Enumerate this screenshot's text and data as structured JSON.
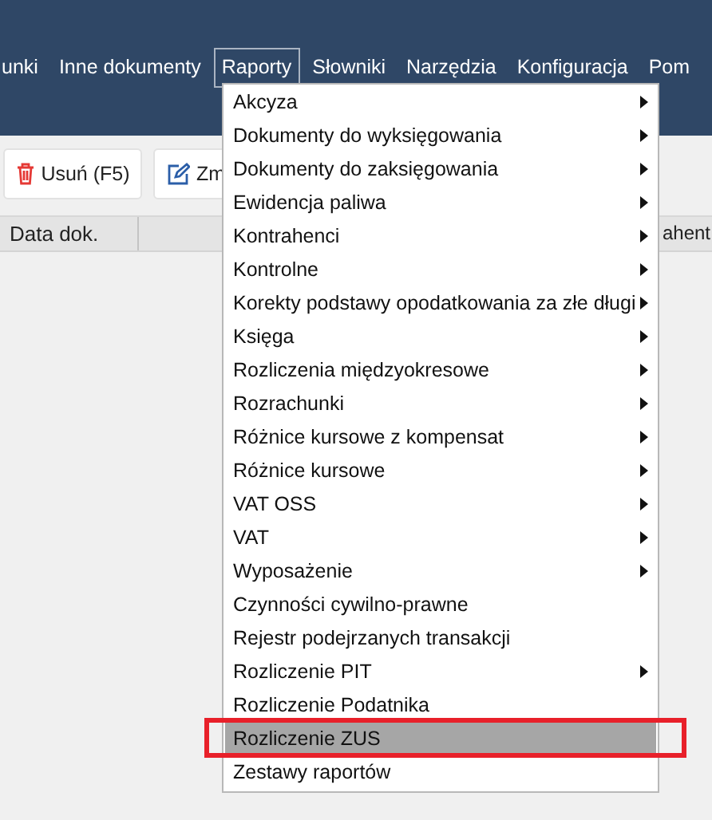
{
  "menu_bar": [
    {
      "label": "unki",
      "open": false
    },
    {
      "label": "Inne dokumenty",
      "open": false
    },
    {
      "label": "Raporty",
      "open": true
    },
    {
      "label": "Słowniki",
      "open": false
    },
    {
      "label": "Narzędzia",
      "open": false
    },
    {
      "label": "Konfiguracja",
      "open": false
    },
    {
      "label": "Pom",
      "open": false
    }
  ],
  "toolbar": [
    {
      "kind": "delete",
      "label": "Usuń (F5)"
    },
    {
      "kind": "edit",
      "label": "Zm"
    }
  ],
  "table": {
    "columns": [
      "Data dok.",
      "ahent"
    ]
  },
  "dropdown": {
    "items": [
      {
        "label": "Akcyza",
        "submenu": true,
        "selected": false
      },
      {
        "label": "Dokumenty do wyksięgowania",
        "submenu": true,
        "selected": false
      },
      {
        "label": "Dokumenty do zaksięgowania",
        "submenu": true,
        "selected": false
      },
      {
        "label": "Ewidencja paliwa",
        "submenu": true,
        "selected": false
      },
      {
        "label": "Kontrahenci",
        "submenu": true,
        "selected": false
      },
      {
        "label": "Kontrolne",
        "submenu": true,
        "selected": false
      },
      {
        "label": "Korekty podstawy opodatkowania za złe długi",
        "submenu": true,
        "selected": false
      },
      {
        "label": "Księga",
        "submenu": true,
        "selected": false
      },
      {
        "label": "Rozliczenia międzyokresowe",
        "submenu": true,
        "selected": false
      },
      {
        "label": "Rozrachunki",
        "submenu": true,
        "selected": false
      },
      {
        "label": "Różnice kursowe z kompensat",
        "submenu": true,
        "selected": false
      },
      {
        "label": "Różnice kursowe",
        "submenu": true,
        "selected": false
      },
      {
        "label": "VAT OSS",
        "submenu": true,
        "selected": false
      },
      {
        "label": "VAT",
        "submenu": true,
        "selected": false
      },
      {
        "label": "Wyposażenie",
        "submenu": true,
        "selected": false
      },
      {
        "label": "Czynności cywilno-prawne",
        "submenu": false,
        "selected": false
      },
      {
        "label": "Rejestr podejrzanych transakcji",
        "submenu": false,
        "selected": false
      },
      {
        "label": "Rozliczenie PIT",
        "submenu": true,
        "selected": false
      },
      {
        "label": "Rozliczenie Podatnika",
        "submenu": false,
        "selected": false
      },
      {
        "label": "Rozliczenie ZUS",
        "submenu": false,
        "selected": true
      },
      {
        "label": "Zestawy raportów",
        "submenu": false,
        "selected": false
      }
    ]
  }
}
